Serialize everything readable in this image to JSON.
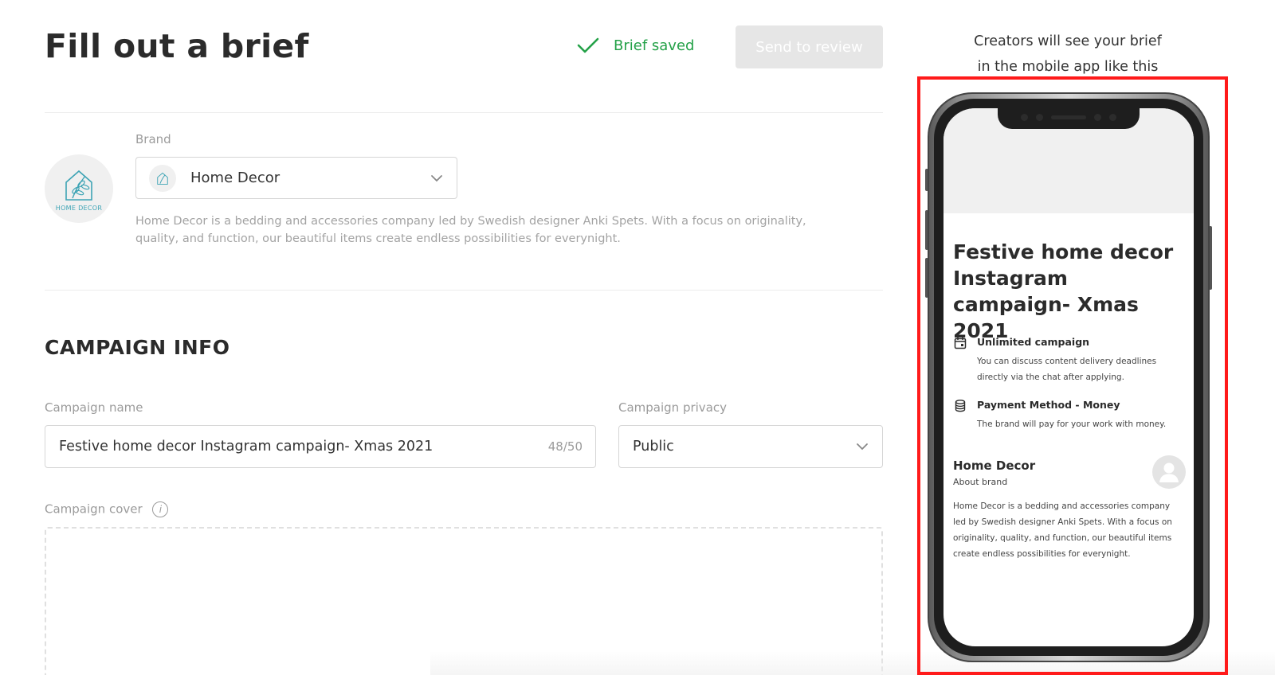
{
  "header": {
    "title": "Fill out a brief",
    "status_label": "Brief saved",
    "review_button": "Send to review"
  },
  "brand": {
    "label": "Brand",
    "logo_text": "HOME DECOR",
    "selected": "Home Decor",
    "description": "Home Decor is a bedding and accessories company led by Swedish designer Anki Spets. With a focus on originality, quality, and function, our beautiful items create endless possibilities for everynight."
  },
  "campaign": {
    "section_title": "CAMPAIGN INFO",
    "name_label": "Campaign name",
    "name_value": "Festive home decor Instagram campaign- Xmas 2021",
    "name_counter": "48/50",
    "privacy_label": "Campaign privacy",
    "privacy_value": "Public",
    "cover_label": "Campaign cover",
    "info_icon_glyph": "i"
  },
  "preview": {
    "caption_line1": "Creators will see your brief",
    "caption_line2": "in the mobile app like this",
    "title": "Festive home decor Instagram campaign- Xmas 2021",
    "rows": [
      {
        "icon": "calendar-icon",
        "title": "Unlimited campaign",
        "text": "You can discuss content delivery deadlines directly via the chat after applying."
      },
      {
        "icon": "coins-icon",
        "title": "Payment Method - Money",
        "text": "The brand will pay for your work with money."
      }
    ],
    "brand_name": "Home Decor",
    "brand_sub": "About brand",
    "brand_desc": "Home Decor is a bedding and accessories company led by Swedish designer Anki Spets. With a focus on originality, quality, and function, our beautiful items create endless possibilities for everynight."
  },
  "colors": {
    "success": "#24a148",
    "disabled_button": "#e6e6e6",
    "highlight_frame": "#ff1a1a",
    "logo_teal": "#3ea4b5"
  }
}
